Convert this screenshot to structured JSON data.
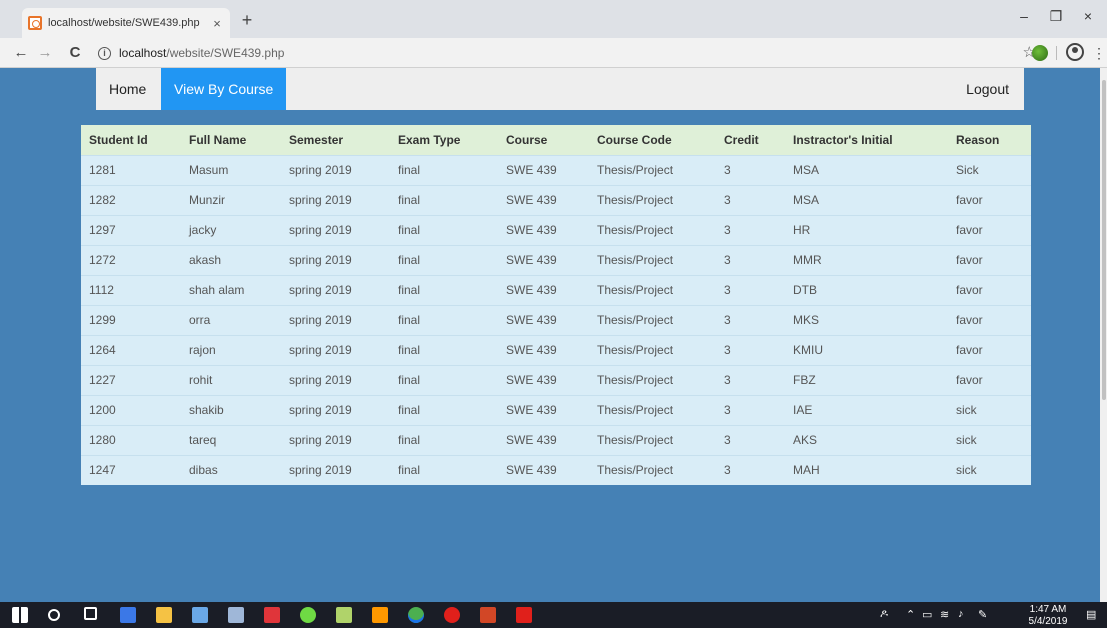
{
  "browser": {
    "tab_title": "localhost/website/SWE439.php",
    "tab_close": "×",
    "new_tab": "+",
    "url_host": "localhost",
    "url_path": "/website/SWE439.php",
    "back": "←",
    "forward": "→",
    "reload": "C",
    "info": "i",
    "star": "☆",
    "menu": "⋮",
    "minimize": "–",
    "restore": "❐",
    "close": "×"
  },
  "nav": {
    "home": "Home",
    "view_by_course": "View By Course",
    "logout": "Logout"
  },
  "table": {
    "headers": [
      "Student Id",
      "Full Name",
      "Semester",
      "Exam Type",
      "Course",
      "Course Code",
      "Credit",
      "Instractor's Initial",
      "Reason"
    ],
    "rows": [
      [
        "1281",
        "Masum",
        "spring 2019",
        "final",
        "SWE 439",
        "Thesis/Project",
        "3",
        "MSA",
        "Sick"
      ],
      [
        "1282",
        "Munzir",
        "spring 2019",
        "final",
        "SWE 439",
        "Thesis/Project",
        "3",
        "MSA",
        "favor"
      ],
      [
        "1297",
        "jacky",
        "spring 2019",
        "final",
        "SWE 439",
        "Thesis/Project",
        "3",
        "HR",
        "favor"
      ],
      [
        "1272",
        "akash",
        "spring 2019",
        "final",
        "SWE 439",
        "Thesis/Project",
        "3",
        "MMR",
        "favor"
      ],
      [
        "1112",
        "shah alam",
        "spring 2019",
        "final",
        "SWE 439",
        "Thesis/Project",
        "3",
        "DTB",
        "favor"
      ],
      [
        "1299",
        "orra",
        "spring 2019",
        "final",
        "SWE 439",
        "Thesis/Project",
        "3",
        "MKS",
        "favor"
      ],
      [
        "1264",
        "rajon",
        "spring 2019",
        "final",
        "SWE 439",
        "Thesis/Project",
        "3",
        "KMIU",
        "favor"
      ],
      [
        "1227",
        "rohit",
        "spring 2019",
        "final",
        "SWE 439",
        "Thesis/Project",
        "3",
        "FBZ",
        "favor"
      ],
      [
        "1200",
        "shakib",
        "spring 2019",
        "final",
        "SWE 439",
        "Thesis/Project",
        "3",
        "IAE",
        "sick"
      ],
      [
        "1280",
        "tareq",
        "spring 2019",
        "final",
        "SWE 439",
        "Thesis/Project",
        "3",
        "AKS",
        "sick"
      ],
      [
        "1247",
        "dibas",
        "spring 2019",
        "final",
        "SWE 439",
        "Thesis/Project",
        "3",
        "MAH",
        "sick"
      ]
    ]
  },
  "taskbar": {
    "time": "1:47 AM",
    "date": "5/4/2019",
    "apps": [
      "start",
      "search",
      "task-view",
      "edge",
      "file-explorer",
      "paint",
      "tools",
      "media",
      "upwork",
      "notepad",
      "sublime",
      "chrome",
      "opera",
      "powerpoint",
      "acrobat"
    ]
  },
  "colors": {
    "page_bg": "#4581b5",
    "active_nav": "#2196f3",
    "header_row": "#dff0d8",
    "data_row": "#d9edf7"
  }
}
